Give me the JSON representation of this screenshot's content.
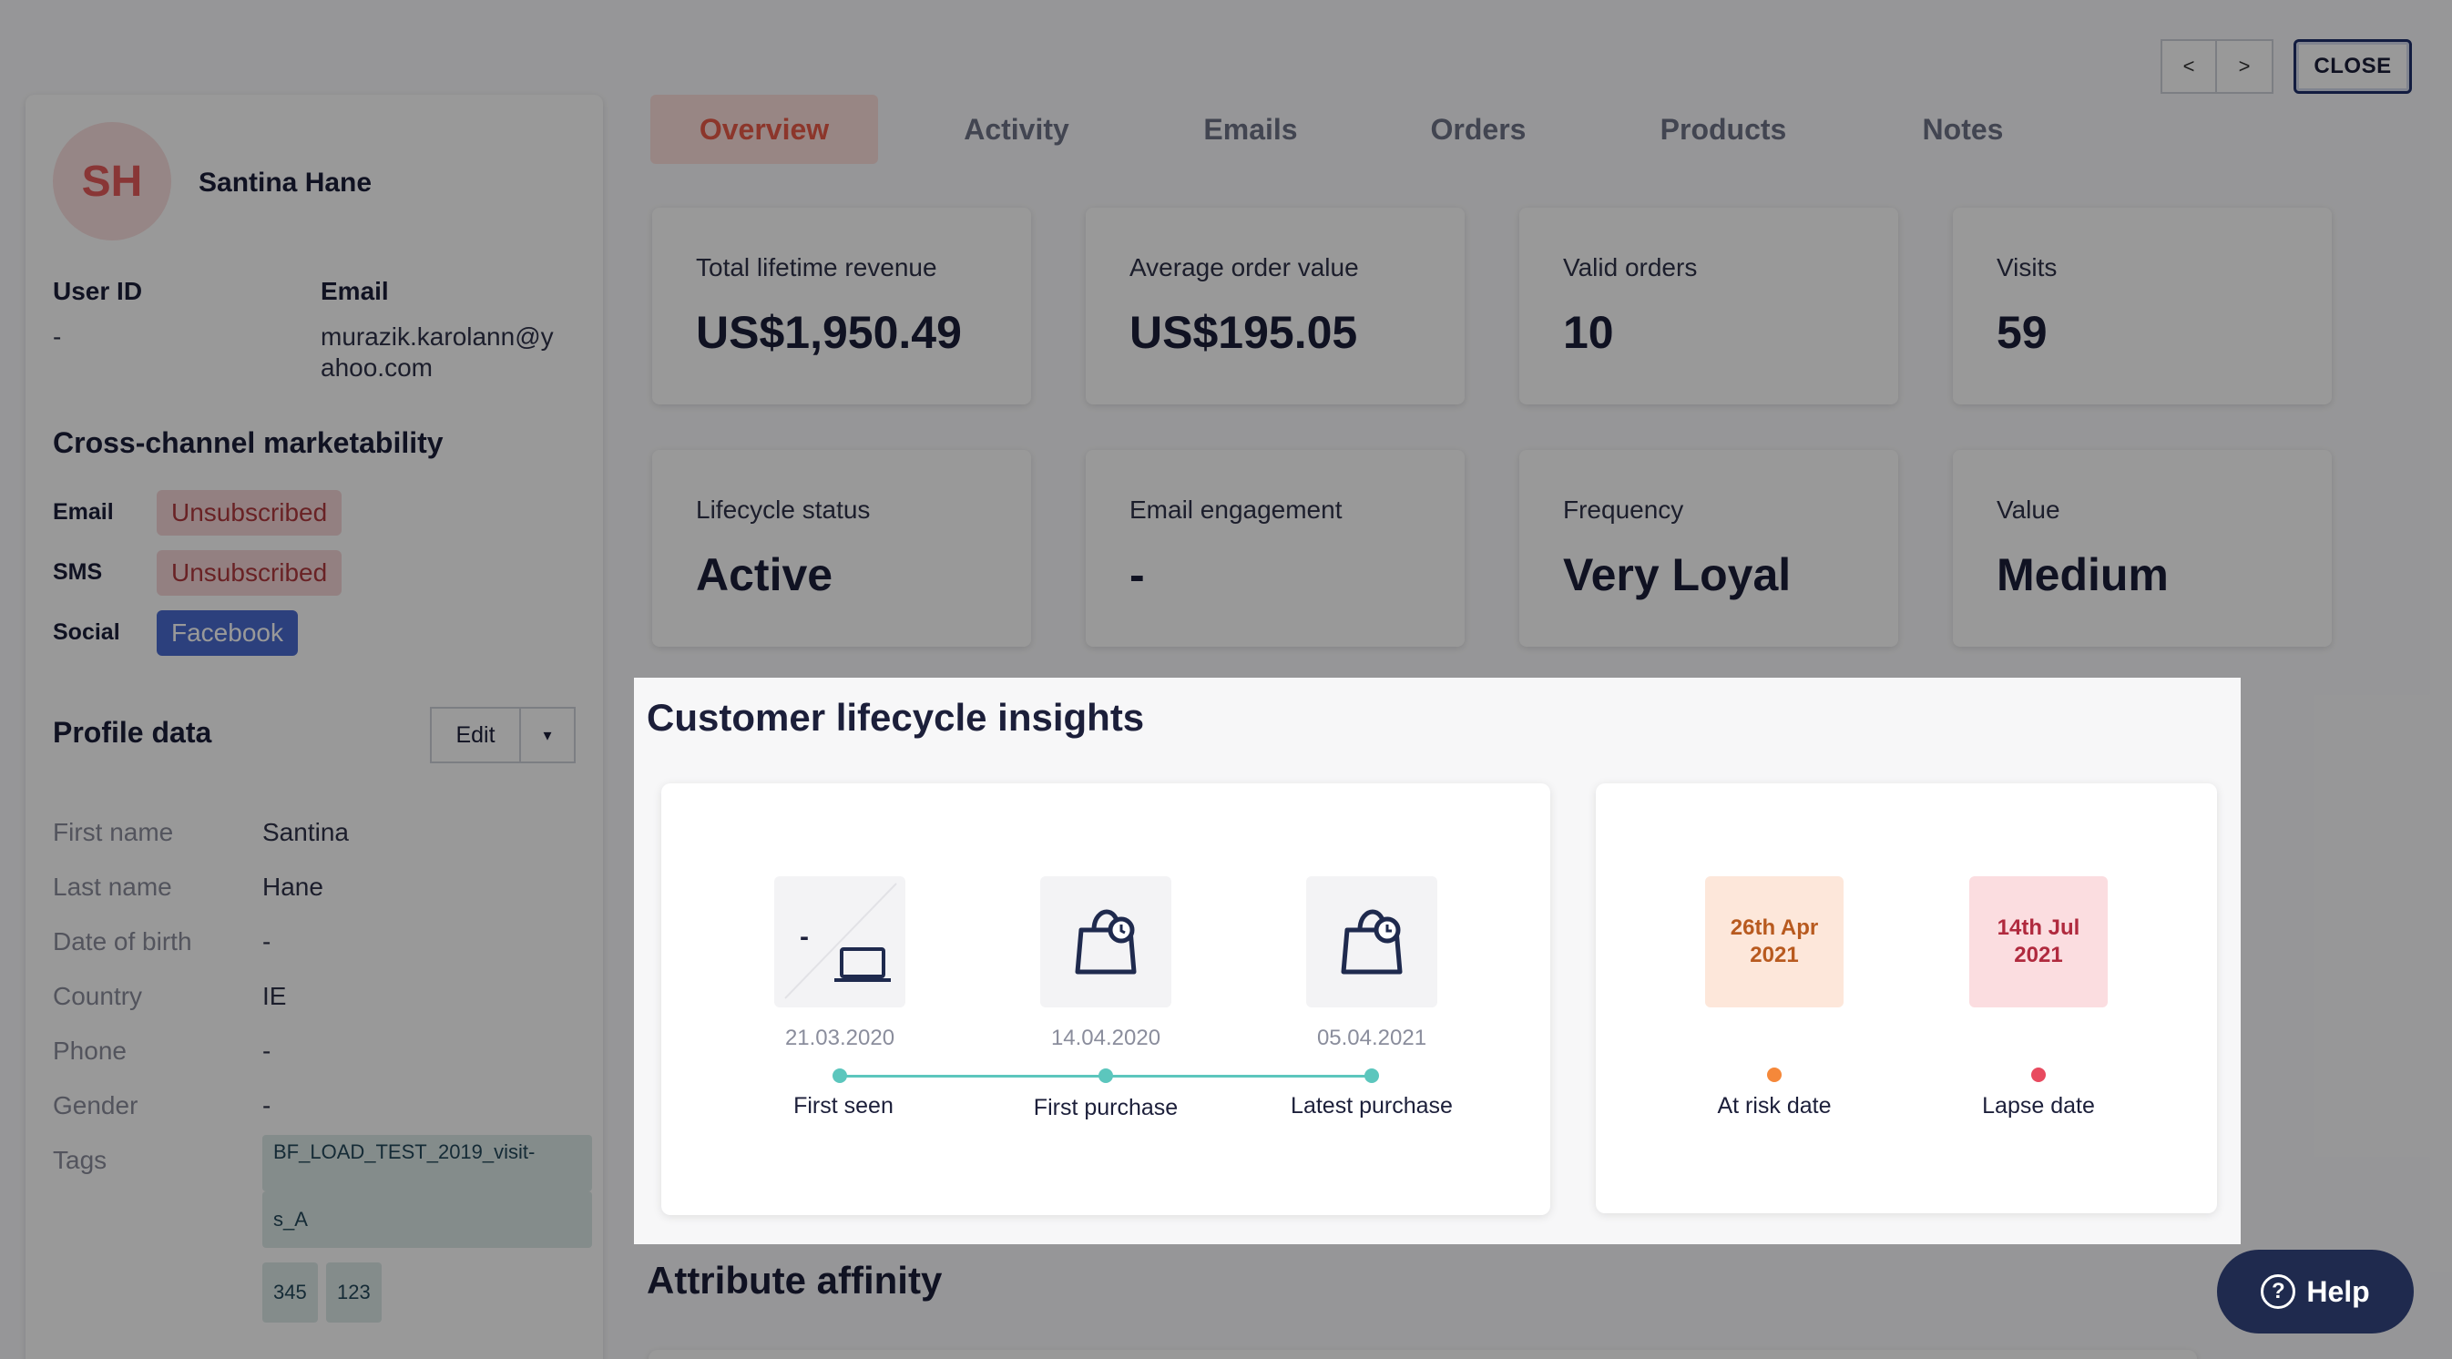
{
  "controls": {
    "prev_label": "<",
    "next_label": ">",
    "close_label": "CLOSE"
  },
  "profile": {
    "initials": "SH",
    "name": "Santina Hane",
    "user_id_label": "User ID",
    "user_id_value": "-",
    "email_label": "Email",
    "email_line1": "murazik.karolann@y",
    "email_line2": "ahoo.com",
    "marketability_title": "Cross-channel marketability",
    "channels": [
      {
        "label": "Email",
        "status": "Unsubscribed"
      },
      {
        "label": "SMS",
        "status": "Unsubscribed"
      },
      {
        "label": "Social",
        "status": "Facebook"
      }
    ],
    "profile_data_title": "Profile data",
    "edit_label": "Edit",
    "fields": [
      {
        "label": "First name",
        "value": "Santina"
      },
      {
        "label": "Last name",
        "value": "Hane"
      },
      {
        "label": "Date of birth",
        "value": "-"
      },
      {
        "label": "Country",
        "value": "IE"
      },
      {
        "label": "Phone",
        "value": "-"
      },
      {
        "label": "Gender",
        "value": "-"
      },
      {
        "label": "Tags",
        "value": ""
      }
    ],
    "tags": [
      "BF_LOAD_TEST_2019_visit-",
      "s_A",
      "345",
      "123"
    ]
  },
  "tabs": [
    "Overview",
    "Activity",
    "Emails",
    "Orders",
    "Products",
    "Notes"
  ],
  "kpis": [
    {
      "label": "Total lifetime revenue",
      "value": "US$1,950.49"
    },
    {
      "label": "Average order value",
      "value": "US$195.05"
    },
    {
      "label": "Valid orders",
      "value": "10"
    },
    {
      "label": "Visits",
      "value": "59"
    },
    {
      "label": "Lifecycle status",
      "value": "Active"
    },
    {
      "label": "Email engagement",
      "value": "-"
    },
    {
      "label": "Frequency",
      "value": "Very Loyal"
    },
    {
      "label": "Value",
      "value": "Medium"
    }
  ],
  "lifecycle": {
    "title": "Customer lifecycle insights",
    "device_value": "-",
    "steps": [
      {
        "date": "21.03.2020",
        "label": "First seen"
      },
      {
        "date": "14.04.2020",
        "label": "First purchase"
      },
      {
        "date": "05.04.2021",
        "label": "Latest purchase"
      }
    ],
    "risk": [
      {
        "date_line1": "26th Apr",
        "date_line2": "2021",
        "label": "At risk date",
        "color": "#f5883a"
      },
      {
        "date_line1": "14th Jul",
        "date_line2": "2021",
        "label": "Lapse date",
        "color": "#e84a5f"
      }
    ]
  },
  "attribute_affinity_title": "Attribute affinity",
  "help_label": "Help"
}
